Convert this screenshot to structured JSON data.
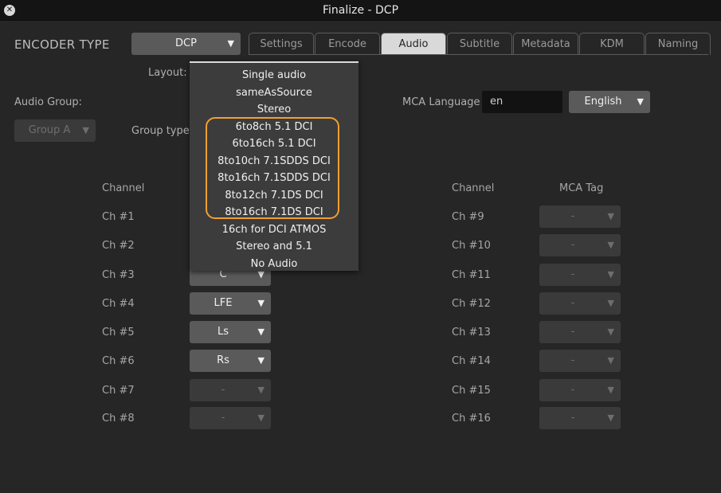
{
  "window": {
    "title": "Finalize - DCP",
    "close_glyph": "✕"
  },
  "encoder": {
    "label": "ENCODER TYPE",
    "value": "DCP"
  },
  "tabs": [
    {
      "label": "Settings"
    },
    {
      "label": "Encode"
    },
    {
      "label": "Audio"
    },
    {
      "label": "Subtitle"
    },
    {
      "label": "Metadata"
    },
    {
      "label": "KDM"
    },
    {
      "label": "Naming"
    }
  ],
  "active_tab": "Audio",
  "layout": {
    "label": "Layout:"
  },
  "audio_group": {
    "label": "Audio Group:",
    "value": "Group A"
  },
  "group_type": {
    "label": "Group type"
  },
  "mca_language": {
    "label": "MCA Language",
    "code": "en",
    "value": "English"
  },
  "left_table": {
    "channel_header": "Channel",
    "rows": [
      {
        "channel": "Ch #1",
        "tag": ""
      },
      {
        "channel": "Ch #2",
        "tag": ""
      },
      {
        "channel": "Ch #3",
        "tag": "C"
      },
      {
        "channel": "Ch #4",
        "tag": "LFE"
      },
      {
        "channel": "Ch #5",
        "tag": "Ls"
      },
      {
        "channel": "Ch #6",
        "tag": "Rs"
      },
      {
        "channel": "Ch #7",
        "tag": "-"
      },
      {
        "channel": "Ch #8",
        "tag": "-"
      }
    ]
  },
  "right_table": {
    "channel_header": "Channel",
    "tag_header": "MCA Tag",
    "rows": [
      {
        "channel": "Ch #9",
        "tag": "-"
      },
      {
        "channel": "Ch #10",
        "tag": "-"
      },
      {
        "channel": "Ch #11",
        "tag": "-"
      },
      {
        "channel": "Ch #12",
        "tag": "-"
      },
      {
        "channel": "Ch #13",
        "tag": "-"
      },
      {
        "channel": "Ch #14",
        "tag": "-"
      },
      {
        "channel": "Ch #15",
        "tag": "-"
      },
      {
        "channel": "Ch #16",
        "tag": "-"
      }
    ]
  },
  "layout_dropdown": {
    "options": [
      "Single audio",
      "sameAsSource",
      "Stereo",
      "6to8ch 5.1 DCI",
      "6to16ch 5.1 DCI",
      "8to10ch 7.1SDDS DCI",
      "8to16ch 7.1SDDS DCI",
      "8to12ch 7.1DS DCI",
      "8to16ch 7.1DS DCI",
      "16ch for DCI ATMOS",
      "Stereo and 5.1",
      "No Audio"
    ],
    "highlight_color": "#f0a030"
  },
  "icons": {
    "chevron": "chevron-down-icon",
    "close": "close-icon"
  }
}
